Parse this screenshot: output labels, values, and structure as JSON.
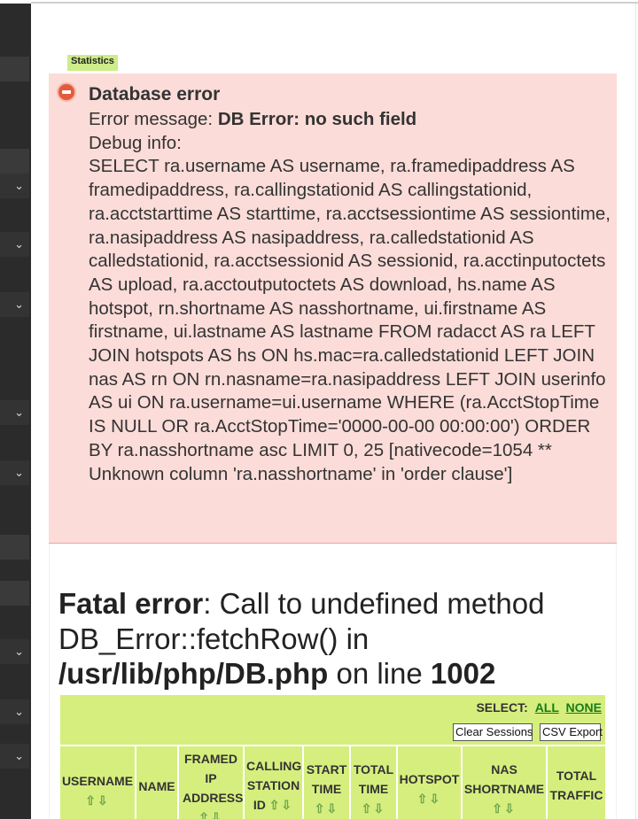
{
  "statistics_tab": "Statistics",
  "error": {
    "title": "Database error",
    "message_label": "Error message: ",
    "message_value": "DB Error: no such field",
    "debug_label": "Debug info:",
    "debug_text": "SELECT ra.username AS username, ra.framedipaddress AS framedipaddress, ra.callingstationid AS callingstationid, ra.acctstarttime AS starttime, ra.acctsessiontime AS sessiontime, ra.nasipaddress AS nasipaddress, ra.calledstationid AS calledstationid, ra.acctsessionid AS sessionid, ra.acctinputoctets AS upload, ra.acctoutputoctets AS download, hs.name AS hotspot, rn.shortname AS nasshortname, ui.firstname AS firstname, ui.lastname AS lastname FROM radacct AS ra LEFT JOIN hotspots AS hs ON hs.mac=ra.calledstationid LEFT JOIN nas AS rn ON rn.nasname=ra.nasipaddress LEFT JOIN userinfo AS ui ON ra.username=ui.username WHERE (ra.AcctStopTime IS NULL OR ra.AcctStopTime='0000-00-00 00:00:00') ORDER BY ra.nasshortname asc LIMIT 0, 25 [nativecode=1054 ** Unknown column 'ra.nasshortname' in 'order clause']"
  },
  "fatal": {
    "label": "Fatal error",
    "message": ": Call to undefined method DB_Error::fetchRow() in ",
    "file": "/usr/lib/php/DB.php",
    "on_line": " on line ",
    "line": "1002"
  },
  "table": {
    "select_label": "SELECT:",
    "all_link": "ALL",
    "none_link": "NONE",
    "clear_sessions": "Clear Sessions",
    "csv_export": "CSV Export",
    "sort_arrows": "⇧⇩",
    "headers": {
      "username": "USERNAME",
      "name": "NAME",
      "framed_ip": "FRAMED IP ADDRESS",
      "calling_station": "CALLING STATION ID",
      "start_time": "START TIME",
      "total_time": "TOTAL TIME",
      "hotspot": "HOTSPOT",
      "nas_shortname": "NAS SHORTNAME",
      "total_traffic": "TOTAL TRAFFIC"
    }
  }
}
